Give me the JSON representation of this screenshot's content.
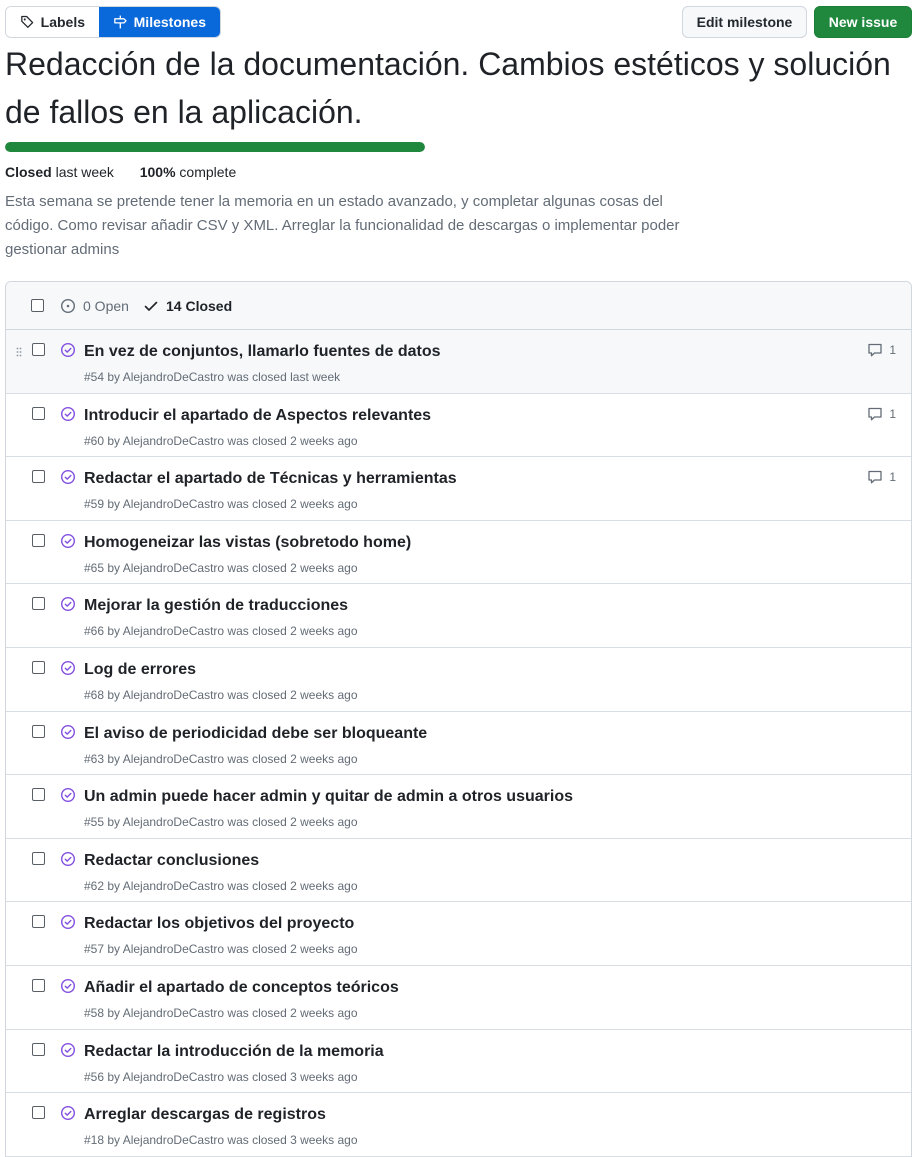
{
  "nav": {
    "labels_tab": "Labels",
    "milestones_tab": "Milestones",
    "active_color": "#0969da"
  },
  "actions": {
    "edit_milestone": "Edit milestone",
    "new_issue": "New issue",
    "new_issue_color": "#1f883d"
  },
  "milestone": {
    "title": "Redacción de la documentación. Cambios estéticos y solución de fallos en la aplicación.",
    "progress_fraction": 1.0,
    "status": "Closed",
    "status_when": "last week",
    "percent": "100%",
    "percent_suffix": "complete",
    "description": "Esta semana se pretende tener la memoria en un estado avanzado, y completar algunas cosas del código. Como revisar añadir CSV y XML. Arreglar la funcionalidad de descargas o implementar poder gestionar admins"
  },
  "list_header": {
    "open_label": "0 Open",
    "closed_label": "14 Closed"
  },
  "issues": [
    {
      "title": "En vez de conjuntos, llamarlo fuentes de datos",
      "meta": "#54 by AlejandroDeCastro was closed last week",
      "comments": "1"
    },
    {
      "title": "Introducir el apartado de Aspectos relevantes",
      "meta": "#60 by AlejandroDeCastro was closed 2 weeks ago",
      "comments": "1"
    },
    {
      "title": "Redactar el apartado de Técnicas y herramientas",
      "meta": "#59 by AlejandroDeCastro was closed 2 weeks ago",
      "comments": "1"
    },
    {
      "title": "Homogeneizar las vistas (sobretodo home)",
      "meta": "#65 by AlejandroDeCastro was closed 2 weeks ago",
      "comments": ""
    },
    {
      "title": "Mejorar la gestión de traducciones",
      "meta": "#66 by AlejandroDeCastro was closed 2 weeks ago",
      "comments": ""
    },
    {
      "title": "Log de errores",
      "meta": "#68 by AlejandroDeCastro was closed 2 weeks ago",
      "comments": ""
    },
    {
      "title": "El aviso de periodicidad debe ser bloqueante",
      "meta": "#63 by AlejandroDeCastro was closed 2 weeks ago",
      "comments": ""
    },
    {
      "title": "Un admin puede hacer admin y quitar de admin a otros usuarios",
      "meta": "#55 by AlejandroDeCastro was closed 2 weeks ago",
      "comments": ""
    },
    {
      "title": "Redactar conclusiones",
      "meta": "#62 by AlejandroDeCastro was closed 2 weeks ago",
      "comments": ""
    },
    {
      "title": "Redactar los objetivos del proyecto",
      "meta": "#57 by AlejandroDeCastro was closed 2 weeks ago",
      "comments": ""
    },
    {
      "title": "Añadir el apartado de conceptos teóricos",
      "meta": "#58 by AlejandroDeCastro was closed 2 weeks ago",
      "comments": ""
    },
    {
      "title": "Redactar la introducción de la memoria",
      "meta": "#56 by AlejandroDeCastro was closed 3 weeks ago",
      "comments": ""
    },
    {
      "title": "Arreglar descargas de registros",
      "meta": "#18 by AlejandroDeCastro was closed 3 weeks ago",
      "comments": ""
    }
  ],
  "icons": {
    "labels_tab": "tag-icon",
    "milestones_tab": "milestone-icon",
    "open_state": "issue-opened-icon",
    "closed_state": "check-icon",
    "issue_state": "issue-closed-icon",
    "comments": "comment-icon",
    "drag": "grabber-icon"
  },
  "colors": {
    "closed_issue_icon": "#8250df",
    "progress": "#1f883d"
  }
}
